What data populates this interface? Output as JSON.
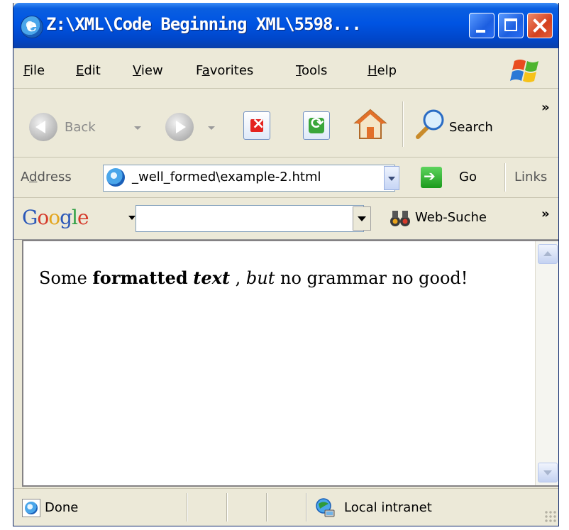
{
  "window": {
    "title": "Z:\\XML\\Code Beginning XML\\5598..."
  },
  "menu": [
    {
      "accel": "F",
      "rest": "ile"
    },
    {
      "accel": "E",
      "rest": "dit"
    },
    {
      "accel": "V",
      "rest": "iew"
    },
    {
      "pre": "F",
      "accel": "a",
      "rest": "vorites"
    },
    {
      "accel": "T",
      "rest": "ools"
    },
    {
      "accel": "H",
      "rest": "elp"
    }
  ],
  "toolbar": {
    "back_label": "Back",
    "search_label": "Search",
    "more_chevron": "»"
  },
  "address": {
    "label_pre": "A",
    "label_accel": "d",
    "label_rest": "dress",
    "url": "_well_formed\\example-2.html",
    "go_label": "Go",
    "links_label": "Links"
  },
  "googlebar": {
    "logo_letters": [
      "G",
      "o",
      "o",
      "g",
      "l",
      "e"
    ],
    "search_value": "",
    "web_search_label": "Web-Suche",
    "more_chevron": "»"
  },
  "content": {
    "part1": "Some ",
    "bold": "formatted",
    "space1": " ",
    "bold_italic": "text",
    "part2": " , ",
    "italic": "but",
    "part3": " no grammar no good!"
  },
  "status": {
    "text": "Done",
    "zone": "Local intranet"
  },
  "colors": {
    "titlebar_blue": "#0054e3",
    "chrome_beige": "#ece9d8",
    "close_red": "#d4411f"
  }
}
